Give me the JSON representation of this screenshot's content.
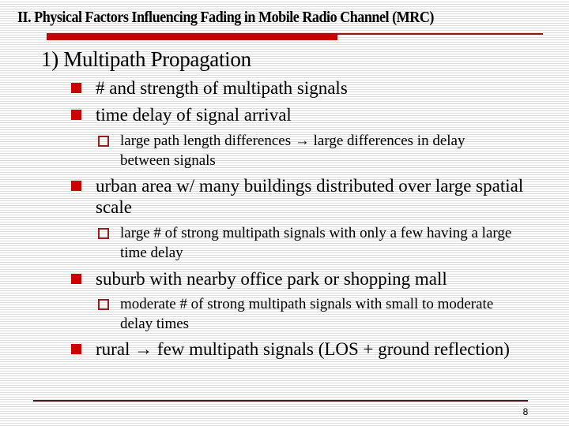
{
  "slide": {
    "title": "II. Physical Factors Influencing Fading in Mobile Radio Channel (MRC)",
    "heading": "1) Multipath Propagation",
    "bullets": [
      {
        "level": 1,
        "text": "# and strength of multipath signals"
      },
      {
        "level": 1,
        "text": "time delay of signal arrival"
      },
      {
        "level": 2,
        "text": "large path length differences → large differences in delay between signals"
      },
      {
        "level": 1,
        "text": "urban area w/ many buildings distributed over large spatial scale"
      },
      {
        "level": 2,
        "text": "large # of strong multipath signals with only a few having a large time delay"
      },
      {
        "level": 1,
        "text": "suburb with nearby office park or shopping mall"
      },
      {
        "level": 2,
        "text": "moderate # of strong multipath signals with small to moderate delay times"
      },
      {
        "level": 1,
        "text": "rural → few multipath signals (LOS + ground reflection)"
      }
    ],
    "page_number": "8",
    "colors": {
      "accent_red": "#cc0000",
      "dark_red": "#8b1a1a"
    }
  }
}
